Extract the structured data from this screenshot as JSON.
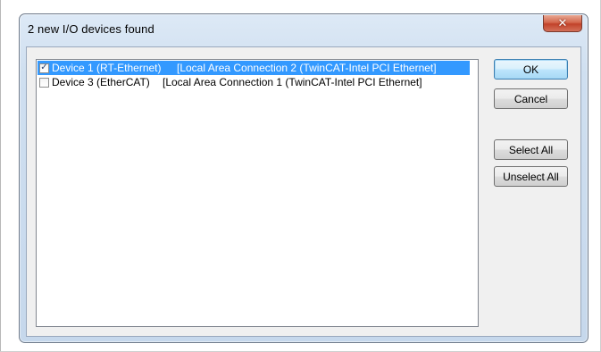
{
  "window": {
    "title": "2 new I/O devices found",
    "close_glyph": "✕"
  },
  "devices": [
    {
      "checked": true,
      "selected": true,
      "device": "Device 1 (RT-Ethernet)",
      "connection": "[Local Area Connection 2 (TwinCAT-Intel PCI Ethernet]"
    },
    {
      "checked": false,
      "selected": false,
      "device": "Device 3 (EtherCAT)",
      "connection": "[Local Area Connection 1 (TwinCAT-Intel PCI Ethernet]"
    }
  ],
  "buttons": {
    "ok": "OK",
    "cancel": "Cancel",
    "select_all": "Select All",
    "unselect_all": "Unselect All"
  },
  "colors": {
    "selection": "#3399ff",
    "close_button": "#c2432a"
  }
}
